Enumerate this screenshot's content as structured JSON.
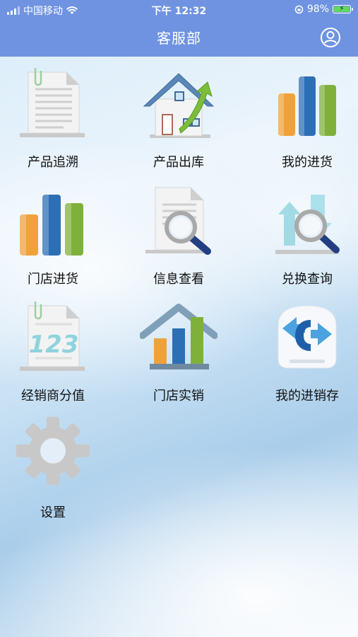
{
  "status_bar": {
    "carrier": "中国移动",
    "time": "下午 12:32",
    "battery": "98%"
  },
  "header": {
    "title": "客服部",
    "profile_icon": "user-circle-icon"
  },
  "menu": [
    {
      "label": "产品追溯",
      "icon": "document-icon"
    },
    {
      "label": "产品出库",
      "icon": "house-arrow-icon"
    },
    {
      "label": "我的进货",
      "icon": "bar-chart-icon"
    },
    {
      "label": "门店进货",
      "icon": "bar-chart-icon"
    },
    {
      "label": "信息查看",
      "icon": "document-search-icon"
    },
    {
      "label": "兑换查询",
      "icon": "exchange-search-icon"
    },
    {
      "label": "经销商分值",
      "icon": "document-123-icon"
    },
    {
      "label": "门店实销",
      "icon": "house-chart-icon"
    },
    {
      "label": "我的进销存",
      "icon": "inventory-arrows-icon"
    },
    {
      "label": "设置",
      "icon": "gear-icon"
    }
  ],
  "colors": {
    "header_bg": "#6f93e1",
    "bar_orange": "#f0a23a",
    "bar_blue": "#2d6fb5",
    "bar_green": "#7fb13a"
  }
}
